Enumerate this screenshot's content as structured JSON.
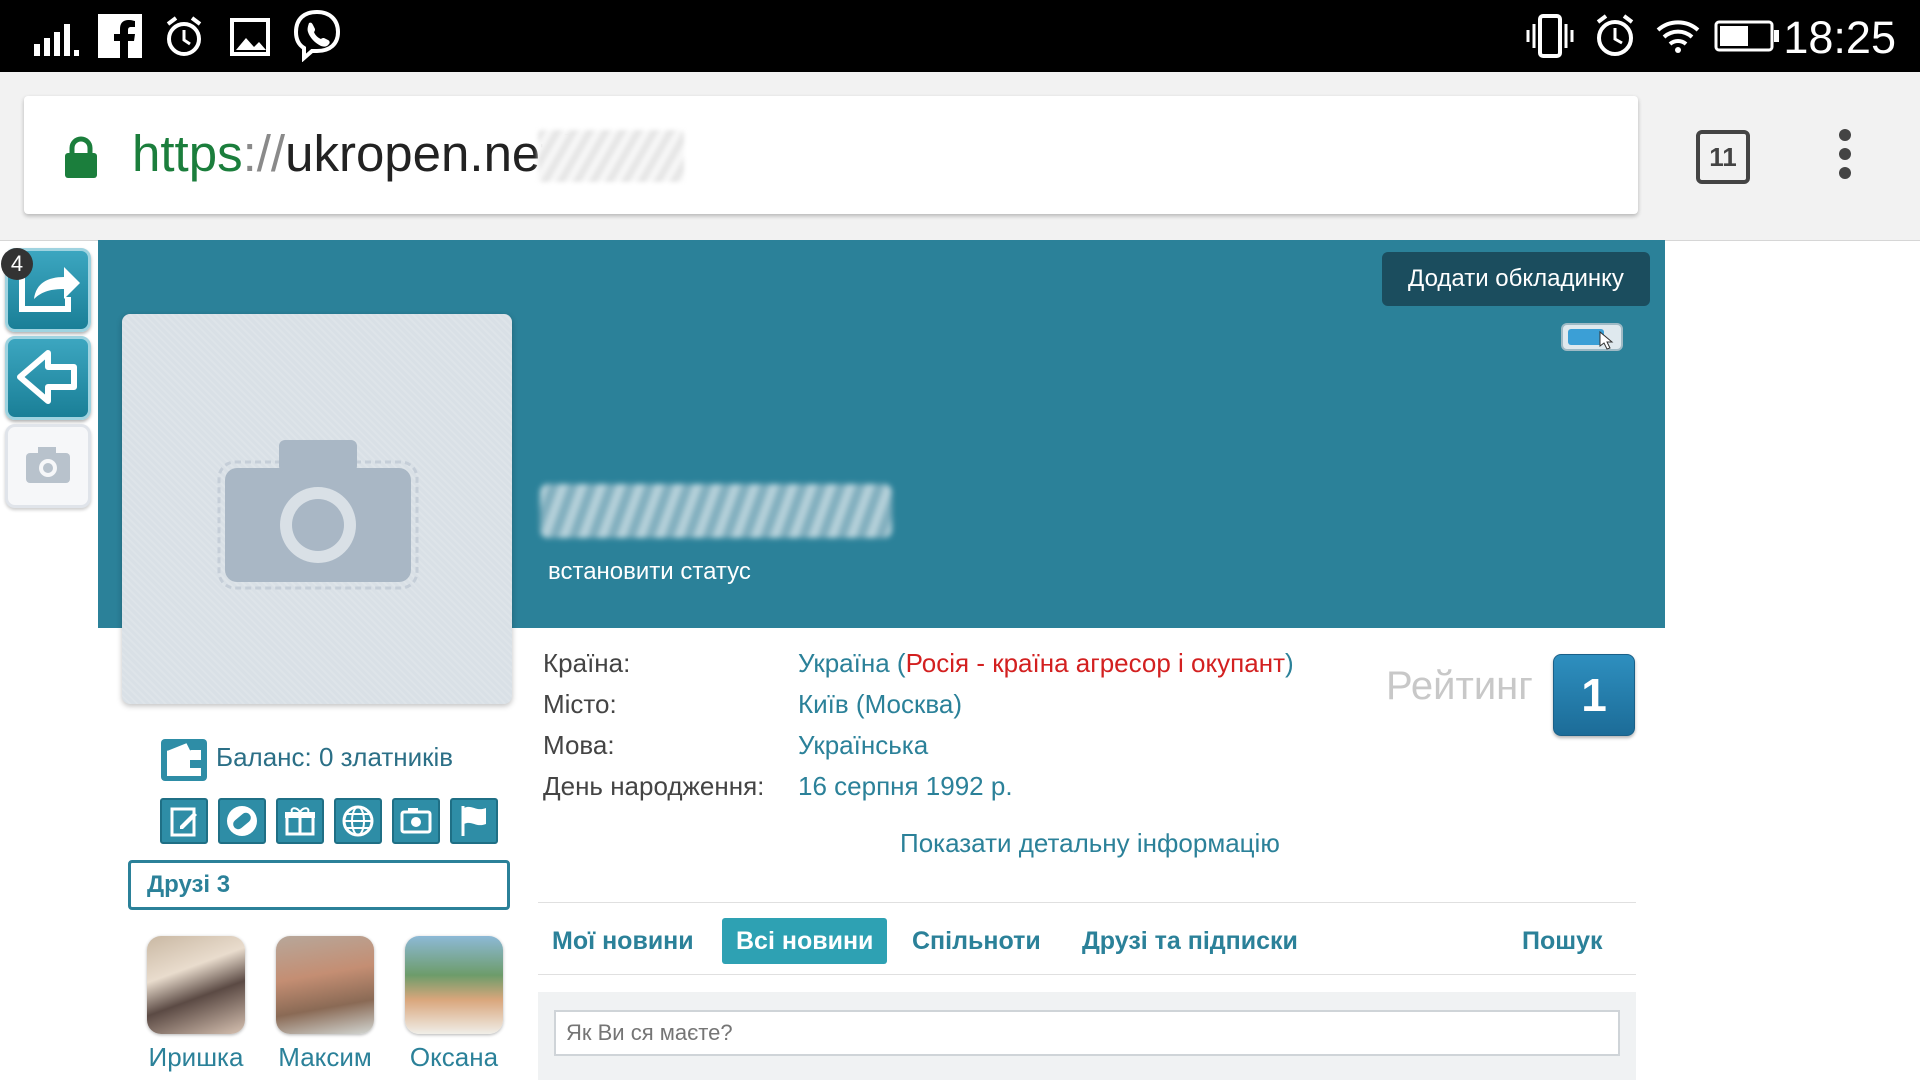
{
  "status_bar": {
    "time": "18:25",
    "left_icons": [
      "signal-icon",
      "facebook-icon",
      "alarm-icon",
      "image-icon",
      "viber-icon"
    ],
    "right_icons": [
      "vibrate-icon",
      "alarm-icon",
      "wifi-icon",
      "battery-icon"
    ]
  },
  "browser": {
    "url_scheme": "https",
    "url_sep": "://",
    "url_host": "ukropen.net/",
    "tab_count": "11"
  },
  "side_toolbar": {
    "share_badge": "4"
  },
  "profile": {
    "add_cover_label": "Додати обкладинку",
    "set_status_label": "встановити статус",
    "balance_label": "Баланс: 0 златників",
    "friends_label": "Друзі 3",
    "friends": [
      {
        "name": "Иришка"
      },
      {
        "name": "Максим"
      },
      {
        "name": "Оксана"
      }
    ],
    "info": {
      "country_label": "Країна:",
      "country_value": "Україна (",
      "country_note": "Росія - країна агресор і окупант",
      "country_close": ")",
      "city_label": "Місто:",
      "city_value": "Київ (Москва)",
      "language_label": "Мова:",
      "language_value": "Українська",
      "birthday_label": "День народження:",
      "birthday_value": "16 серпня 1992 р.",
      "show_more": "Показати детальну інформацію"
    },
    "rating_label": "Рейтинг",
    "rating_value": "1",
    "tabs": [
      {
        "label": "Мої новини"
      },
      {
        "label": "Всі новини",
        "active": true
      },
      {
        "label": "Спільноти"
      },
      {
        "label": "Друзі та підписки"
      },
      {
        "label": "Пошук"
      }
    ],
    "post_placeholder": "Як Ви ся маєте?"
  },
  "colors": {
    "cover": "#2b8199",
    "accent": "#2b8199",
    "active_tab": "#2ea1b3",
    "warning_text": "#d32020",
    "secure_green": "#1b7e3c"
  }
}
